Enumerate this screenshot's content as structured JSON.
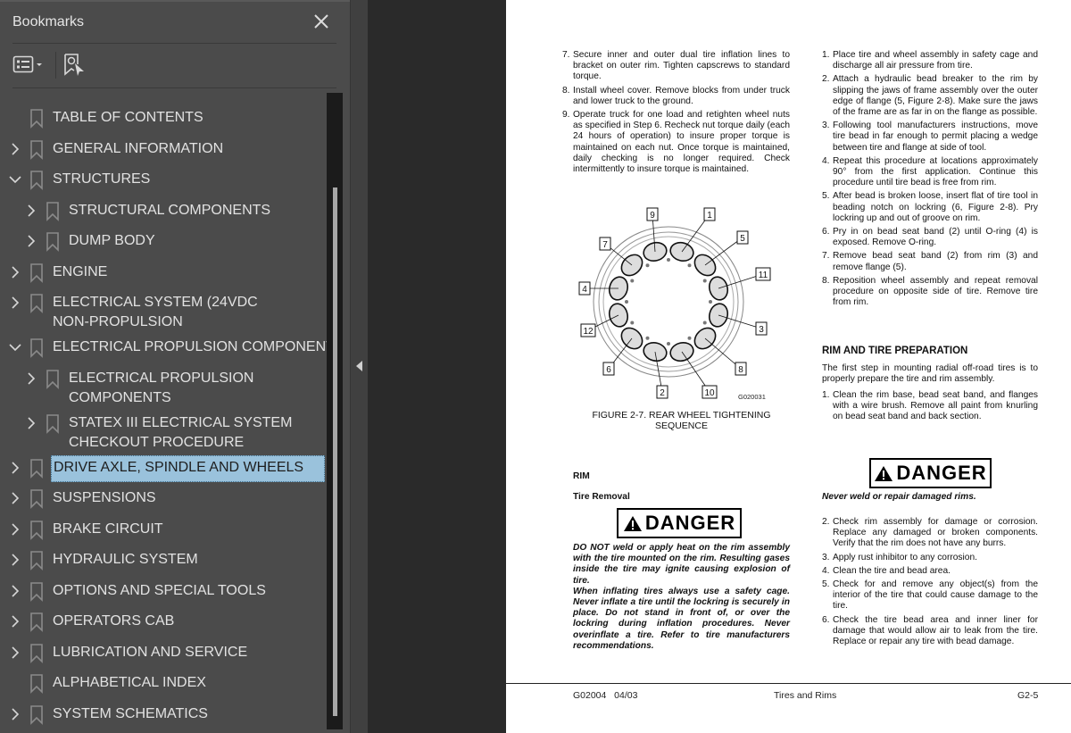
{
  "sidebar": {
    "title": "Bookmarks",
    "close_icon": "close-icon",
    "tools": {
      "list_view_icon": "list-options-icon",
      "find_bookmark_icon": "find-current-bookmark-icon"
    },
    "items": [
      {
        "label": "TABLE OF CONTENTS",
        "level": 0,
        "expander": "none"
      },
      {
        "label": "GENERAL INFORMATION",
        "level": 0,
        "expander": "collapsed"
      },
      {
        "label": "STRUCTURES",
        "level": 0,
        "expander": "expanded"
      },
      {
        "label": "STRUCTURAL COMPONENTS",
        "level": 1,
        "expander": "collapsed"
      },
      {
        "label": "DUMP BODY",
        "level": 1,
        "expander": "collapsed"
      },
      {
        "label": "ENGINE",
        "level": 0,
        "expander": "collapsed"
      },
      {
        "label": "ELECTRICAL SYSTEM (24VDC",
        "label2": "NON-PROPULSION",
        "level": 0,
        "expander": "collapsed"
      },
      {
        "label": "ELECTRICAL PROPULSION COMPONENTS",
        "level": 0,
        "expander": "expanded"
      },
      {
        "label": "ELECTRICAL PROPULSION",
        "label2": "COMPONENTS",
        "level": 1,
        "expander": "collapsed"
      },
      {
        "label": "STATEX III ELECTRICAL SYSTEM",
        "label2": "CHECKOUT PROCEDURE",
        "level": 1,
        "expander": "collapsed"
      },
      {
        "label": "DRIVE AXLE, SPINDLE AND WHEELS",
        "level": 0,
        "expander": "collapsed",
        "selected": true
      },
      {
        "label": "SUSPENSIONS",
        "level": 0,
        "expander": "collapsed"
      },
      {
        "label": "BRAKE CIRCUIT",
        "level": 0,
        "expander": "collapsed"
      },
      {
        "label": "HYDRAULIC SYSTEM",
        "level": 0,
        "expander": "collapsed"
      },
      {
        "label": "OPTIONS AND SPECIAL TOOLS",
        "level": 0,
        "expander": "collapsed"
      },
      {
        "label": "OPERATORS CAB",
        "level": 0,
        "expander": "collapsed"
      },
      {
        "label": "LUBRICATION AND SERVICE",
        "level": 0,
        "expander": "collapsed"
      },
      {
        "label": "ALPHABETICAL INDEX",
        "level": 0,
        "expander": "none"
      },
      {
        "label": "SYSTEM SCHEMATICS",
        "level": 0,
        "expander": "collapsed"
      }
    ]
  },
  "page": {
    "left_col": {
      "steps": [
        {
          "n": "7.",
          "text": "Secure inner and outer dual tire inflation lines to bracket on outer rim. Tighten capscrews to standard torque."
        },
        {
          "n": "8.",
          "text": "Install wheel cover. Remove blocks from under truck and lower truck to the ground."
        },
        {
          "n": "9.",
          "text": "Operate truck for one load and retighten wheel nuts as specified in Step 6. Recheck nut torque daily (each 24 hours of operation) to insure proper torque is maintained on each nut. Once torque is maintained, daily checking is no longer required. Check intermittently to insure torque is maintained."
        }
      ],
      "figure": {
        "callouts": [
          "1",
          "2",
          "3",
          "4",
          "5",
          "6",
          "7",
          "8",
          "9",
          "10",
          "11",
          "12"
        ],
        "figure_id": "G020031",
        "caption_line1": "FIGURE 2-7. REAR WHEEL TIGHTENING",
        "caption_line2": "SEQUENCE"
      },
      "rim_heading": "RIM",
      "tire_removal_heading": "Tire Removal",
      "danger_label": "DANGER",
      "danger_text": "DO NOT weld or apply heat on the rim assembly with the tire mounted on the rim. Resulting gases inside the tire may ignite causing explosion of tire.",
      "danger_text2": "When inflating tires always use a safety cage. Never inflate a tire until the lockring is securely in place. Do not stand in front of, or over the lockring during inflation procedures. Never overinflate a tire. Refer to tire manufacturers recommendations."
    },
    "right_col": {
      "steps": [
        {
          "n": "1.",
          "text": "Place tire and wheel assembly in safety cage and discharge all air pressure from tire."
        },
        {
          "n": "2.",
          "text": "Attach a hydraulic bead breaker to the rim by slipping the jaws of frame assembly over the outer edge of flange (5, Figure 2-8). Make sure the jaws of the frame are as far in on the flange as possible."
        },
        {
          "n": "3.",
          "text": "Following tool manufacturers instructions, move tire bead in far enough to permit placing a wedge between tire and flange at side of tool."
        },
        {
          "n": "4.",
          "text": "Repeat this procedure at locations approximately 90° from the first application. Continue this procedure until tire bead is free from rim."
        },
        {
          "n": "5.",
          "text": "After bead is broken loose, insert flat of tire tool in beading notch on lockring (6, Figure 2-8). Pry lockring up and out of groove on rim."
        },
        {
          "n": "6.",
          "text": "Pry in on bead seat band (2) until O-ring (4) is exposed. Remove O-ring."
        },
        {
          "n": "7.",
          "text": "Remove bead seat band (2) from rim (3) and remove flange (5)."
        },
        {
          "n": "8.",
          "text": "Reposition wheel assembly and repeat removal procedure on opposite side of tire. Remove tire from rim."
        }
      ],
      "prep_heading": "RIM AND TIRE PREPARATION",
      "prep_intro": "The first step in mounting radial off-road tires is to properly prepare the tire and rim assembly.",
      "prep_steps1": [
        {
          "n": "1.",
          "text": "Clean the rim base, bead seat band, and flanges with a wire brush. Remove all paint from knurling on bead seat band and back section."
        }
      ],
      "danger_label": "DANGER",
      "danger_text": "Never weld or repair damaged rims.",
      "prep_steps2": [
        {
          "n": "2.",
          "text": "Check rim assembly for damage or corrosion. Replace any damaged or broken components. Verify that the rim does not have any burrs."
        },
        {
          "n": "3.",
          "text": "Apply rust inhibitor to any corrosion."
        },
        {
          "n": "4.",
          "text": "Clean the tire and bead area."
        },
        {
          "n": "5.",
          "text": "Check for and remove any object(s) from the interior of the tire that could cause damage to the tire."
        },
        {
          "n": "6.",
          "text": "Check the tire bead area and inner liner for damage that would allow air to leak from the tire. Replace or repair any tire with bead damage."
        }
      ]
    },
    "footer": {
      "doc_code": "G02004",
      "date": "04/03",
      "section": "Tires and Rims",
      "page_number": "G2-5"
    }
  }
}
